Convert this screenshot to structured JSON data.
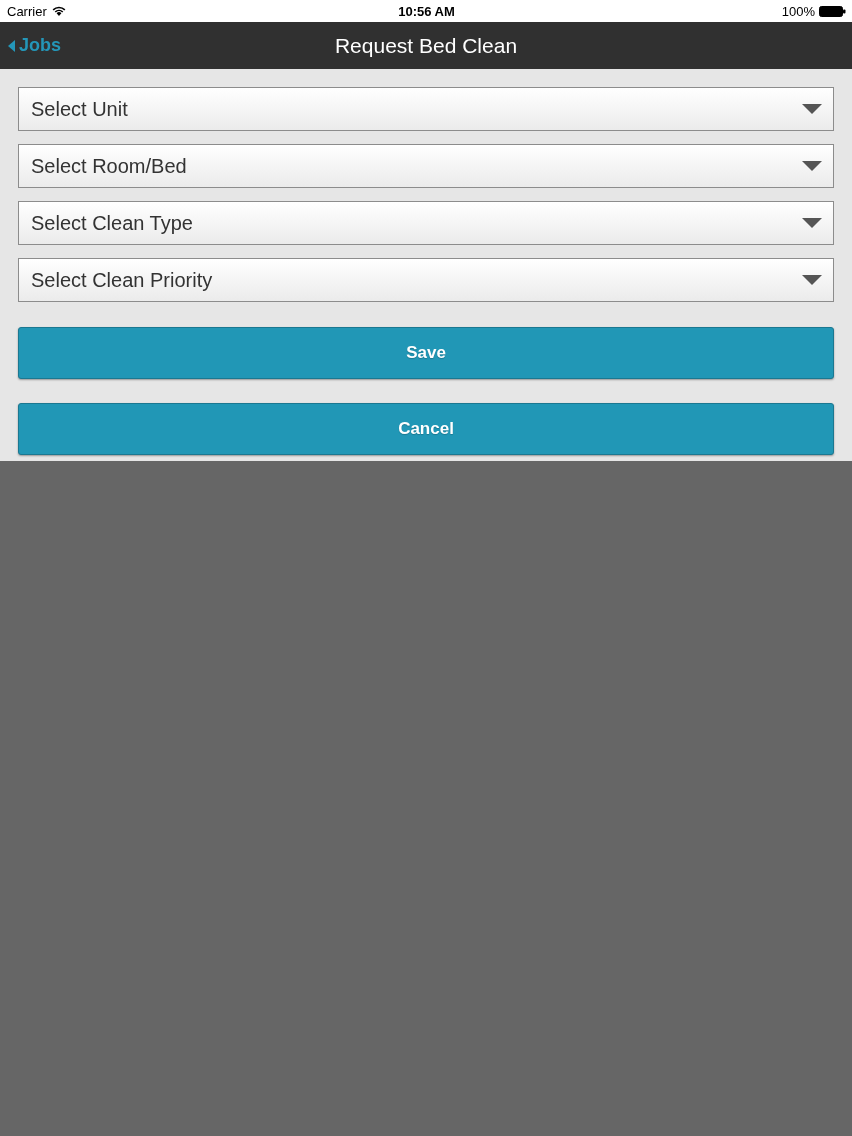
{
  "status_bar": {
    "carrier": "Carrier",
    "time": "10:56 AM",
    "battery": "100%"
  },
  "nav_bar": {
    "back": "Jobs",
    "title": "Request Bed Clean"
  },
  "selects": [
    {
      "placeholder": "Select Unit"
    },
    {
      "placeholder": "Select Room/Bed"
    },
    {
      "placeholder": "Select Clean Type"
    },
    {
      "placeholder": "Select Clean Priority"
    }
  ],
  "buttons": [
    {
      "label": "Save"
    },
    {
      "label": "Cancel"
    }
  ]
}
